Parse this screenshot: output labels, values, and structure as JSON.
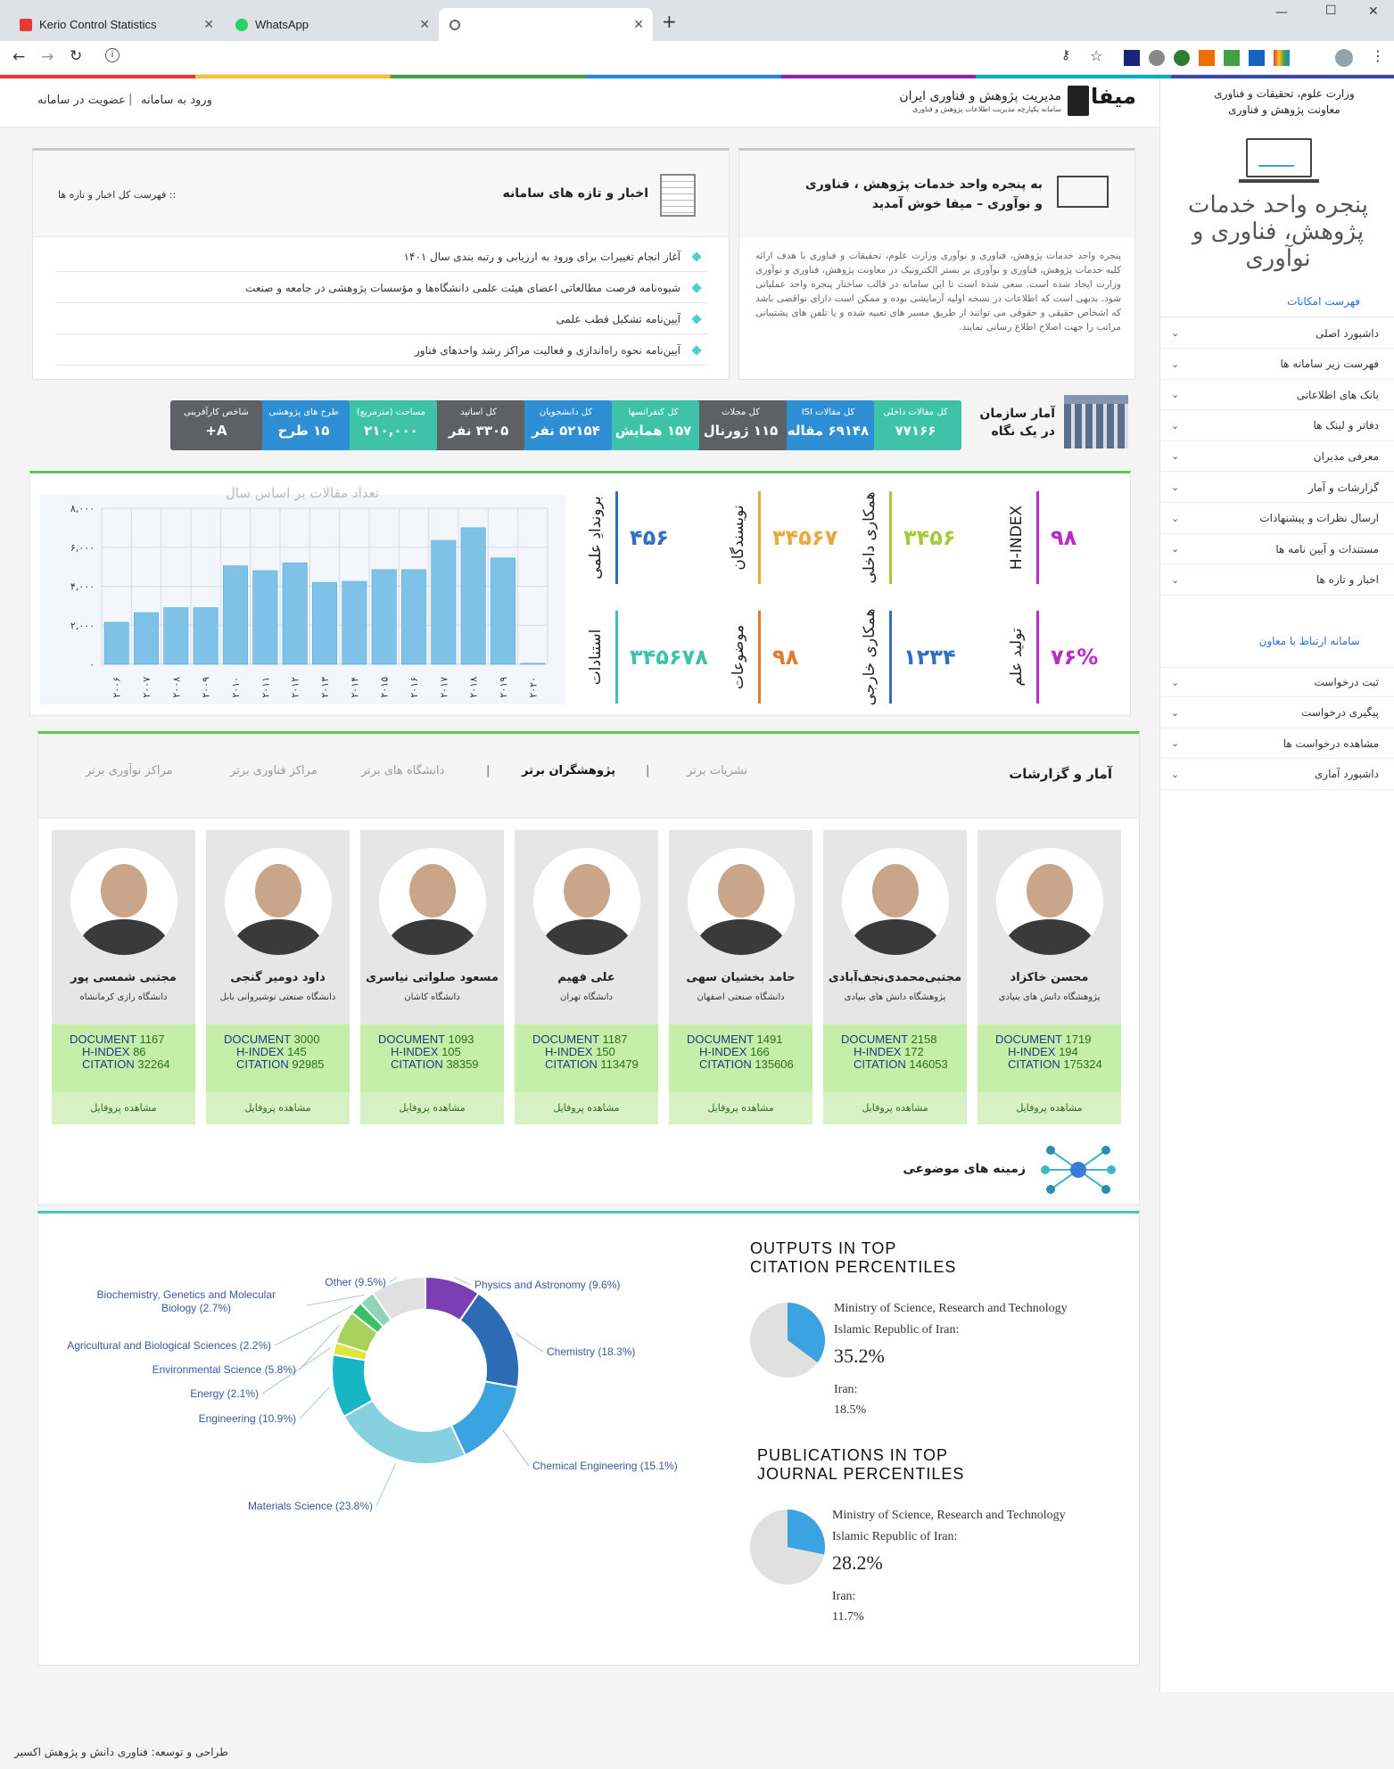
{
  "browser": {
    "tabs": [
      {
        "title": "Kerio Control Statistics"
      },
      {
        "title": "WhatsApp"
      },
      {
        "title": ""
      }
    ],
    "new_tab": "+",
    "window_controls": [
      "—",
      "☐",
      "✕"
    ],
    "address": ""
  },
  "header": {
    "ministry_line1": "وزارت علوم، تحقیقات و فناوری",
    "ministry_line2": "معاونت پژوهش و فناوری",
    "brand_title": "مدیریت پژوهش و فناوری ایران",
    "brand_subtitle": "سامانه یکپارچه مدیریت اطلاعات پژوهش و فناوری",
    "logo_text": "میفا",
    "login": "ورود به سامانه",
    "separator": "|",
    "register": "عضویت در سامانه"
  },
  "sidebar": {
    "hero_text": "پنجره واحد خدمات پژوهش، فناوری و نوآوری",
    "menu_title": "فهرست امکانات",
    "items": [
      {
        "label": "داشبورد اصلی"
      },
      {
        "label": "فهرست زیر سامانه ها"
      },
      {
        "label": "بانک های اطلاعاتی"
      },
      {
        "label": "دفاتر و لینک ها"
      },
      {
        "label": "معرفی مدیران"
      },
      {
        "label": "گزارشات و آمار"
      },
      {
        "label": "ارسال نظرات و پیشنهادات"
      },
      {
        "label": "مستندات و آیین نامه ها"
      },
      {
        "label": "اخبار و تازه ها"
      }
    ],
    "contact_title": "سامانه ارتباط با معاون",
    "contact_items": [
      {
        "label": "ثبت درخواست"
      },
      {
        "label": "پیگیری درخواست"
      },
      {
        "label": "مشاهده درخواست ها"
      },
      {
        "label": "داشبورد آماری"
      }
    ]
  },
  "welcome": {
    "title_line1": "به پنجره واحد خدمات پژوهش ، فناوری",
    "title_line2": "و نوآوری – میفا خوش آمدید",
    "body": "پنجره واحد خدمات پژوهش، فناوری و نوآوری وزارت علوم، تحقیقات و فناوری با هدف ارائه کلیه خدمات پژوهش، فناوری و نوآوری بر بستر الکترونیک در معاونت پژوهش، فناوری و نوآوری وزارت ایجاد شده است. سعی شده است تا این سامانه در قالب ساختار پنجره واحد عملیاتی شود. بدیهی است که اطلاعات در نسخه اولیه آزمایشی بوده و ممکن است دارای نواقصی باشد که اشخاص حقیقی و حقوقی می توانند از طریق مسیر های تعبیه شده و یا تلفن های پشتیبانی مراتب را جهت اصلاح اطلاع رسانی نمایند."
  },
  "news": {
    "title": "اخبار و تازه های سامانه",
    "all_link": ":: فهرست کل اخبار و تازه ها",
    "items": [
      {
        "text": "آغاز انجام تغییرات برای ورود به ارزیابی و رتبه بندی سال ۱۴۰۱"
      },
      {
        "text": "شیوه‌نامه فرصت مطالعاتی اعضای هیئت علمی دانشگاه‌ها و مؤسسات پژوهشی در جامعه و صنعت"
      },
      {
        "text": "آیین‌نامه تشکیل قطب علمی"
      },
      {
        "text": "آیین‌نامه نحوه راه‌اندازی و فعالیت مراکز رشد واحدهای فناور"
      }
    ]
  },
  "org_stats": {
    "title_line1": "آمار سازمان",
    "title_line2": "در یک نگاه",
    "boxes": [
      {
        "label": "کل مقالات داخلی",
        "value": "۷۷۱۶۶",
        "color": "#3ec3a9"
      },
      {
        "label": "کل مقالات ISI",
        "value": "۶۹۱۴۸ مقاله",
        "color": "#2f8fd4"
      },
      {
        "label": "کل مجلات",
        "value": "۱۱۵ ژورنال",
        "color": "#5d6166"
      },
      {
        "label": "کل کنفرانسها",
        "value": "۱۵۷ همایش",
        "color": "#3ec3a9"
      },
      {
        "label": "کل دانشجویان",
        "value": "۵۲۱۵۴ نفر",
        "color": "#2f8fd4"
      },
      {
        "label": "کل اساتید",
        "value": "۳۳۰۵ نفر",
        "color": "#5d6166"
      },
      {
        "label": "مساحت (مترمربع)",
        "value": "۲۱۰,۰۰۰",
        "color": "#3ec3a9"
      },
      {
        "label": "طرح های پژوهشی",
        "value": "۱۵ طرح",
        "color": "#2f8fd4"
      },
      {
        "label": "شاخص کارآفرینی",
        "value": "A+",
        "color": "#5d6166"
      }
    ]
  },
  "kpis": [
    {
      "label": "H-INDEX",
      "value": "۹۸",
      "color": "#b72ec7"
    },
    {
      "label": "همکاری داخلی",
      "value": "۳۴۵۶",
      "color": "#a5c93a"
    },
    {
      "label": "نویسندگان",
      "value": "۳۴۵۶۷",
      "color": "#e9a83a"
    },
    {
      "label": "بروندادِ علمی",
      "value": "۴۵۶",
      "color": "#2f6fbf"
    },
    {
      "label": "تولید علم",
      "value": "۷۶%",
      "color": "#b72ec7"
    },
    {
      "label": "همکاری خارجی",
      "value": "۱۲۳۴",
      "color": "#2f6fbf"
    },
    {
      "label": "موضوعات",
      "value": "۹۸",
      "color": "#e07b2d"
    },
    {
      "label": "استنادات",
      "value": "۳۴۵۶۷۸",
      "color": "#3ec3a9"
    }
  ],
  "chart_data": [
    {
      "type": "bar",
      "title": "تعداد مقالات بر اساس سال",
      "categories": [
        "۲۰۰۶",
        "۲۰۰۷",
        "۲۰۰۸",
        "۲۰۰۹",
        "۲۰۱۰",
        "۲۰۱۱",
        "۲۰۱۲",
        "۲۰۱۳",
        "۲۰۱۴",
        "۲۰۱۵",
        "۲۰۱۶",
        "۲۰۱۷",
        "۲۰۱۸",
        "۲۰۱۹",
        "۲۰۲۰"
      ],
      "values": [
        2150,
        2650,
        2900,
        2900,
        5050,
        4800,
        5200,
        4200,
        4250,
        4850,
        4850,
        6350,
        7000,
        5450,
        50
      ],
      "ylim": [
        0,
        8000
      ],
      "yticks": [
        "۰",
        "۲,۰۰۰",
        "۴,۰۰۰",
        "۶,۰۰۰",
        "۸,۰۰۰"
      ],
      "bar_color": "#7ec2e8",
      "grid": true
    },
    {
      "type": "pie",
      "categories": [
        "Physics and Astronomy",
        "Chemistry",
        "Chemical Engineering",
        "Materials Science",
        "Engineering",
        "Energy",
        "Environmental Science",
        "Agricultural and Biological Sciences",
        "Biochemistry, Genetics and Molecular Biology",
        "Other"
      ],
      "labels": [
        "Physics and Astronomy (9.6%)",
        "Chemistry (18.3%)",
        "Chemical Engineering (15.1%)",
        "Materials Science (23.8%)",
        "Engineering (10.9%)",
        "Energy (2.1%)",
        "Environmental Science (5.8%)",
        "Agricultural and Biological Sciences (2.2%)",
        "Biochemistry, Genetics and Molecular Biology (2.7%)",
        "Other (9.5%)"
      ],
      "values": [
        9.6,
        18.3,
        15.1,
        23.8,
        10.9,
        2.1,
        5.8,
        2.2,
        2.7,
        9.5
      ],
      "colors": [
        "#7b3fb3",
        "#2b6cb5",
        "#3aa3e0",
        "#86d0e0",
        "#16b6c4",
        "#dfe63a",
        "#a6d15a",
        "#3bbf6a",
        "#8fd3b8",
        "#e0e0e0"
      ]
    },
    {
      "type": "pie",
      "title": "OUTPUTS IN TOP CITATION PERCENTILES",
      "categories": [
        "Ministry of Science, Research and Technology Islamic Republic of Iran",
        "Other"
      ],
      "values": [
        35.2,
        64.8
      ],
      "colors": [
        "#3aa3e0",
        "#e0e0e0"
      ]
    },
    {
      "type": "pie",
      "title": "PUBLICATIONS IN TOP JOURNAL PERCENTILES",
      "categories": [
        "Ministry of Science, Research and Technology Islamic Republic of Iran",
        "Other"
      ],
      "values": [
        28.2,
        71.8
      ],
      "colors": [
        "#3aa3e0",
        "#e0e0e0"
      ]
    }
  ],
  "reports": {
    "title": "آمار و گزارشات",
    "tabs": [
      {
        "label": "نشریات برتر"
      },
      {
        "label": "پژوهشگران برتر"
      },
      {
        "label": "دانشگاه های برتر"
      },
      {
        "label": "مراکز فناوری برتر"
      },
      {
        "label": "مراکز نوآوری برتر"
      }
    ],
    "sep": "|"
  },
  "researchers": [
    {
      "name": "محسن خاکزاد",
      "uni": "پژوهشگاه دانش های بنیادی",
      "document": "1719",
      "hindex": "194",
      "citation": "175324",
      "link": "مشاهده پروفایل"
    },
    {
      "name": "مجتبی‌محمدی‌نجف‌آبادی",
      "uni": "پژوهشگاه دانش های بنیادی",
      "document": "2158",
      "hindex": "172",
      "citation": "146053",
      "link": "مشاهده پروفایل"
    },
    {
      "name": "حامد بخشیان سهی",
      "uni": "دانشگاه صنعتی اصفهان",
      "document": "1491",
      "hindex": "166",
      "citation": "135606",
      "link": "مشاهده پروفایل"
    },
    {
      "name": "علی فهیم",
      "uni": "دانشگاه تهران",
      "document": "1187",
      "hindex": "150",
      "citation": "113479",
      "link": "مشاهده پروفایل"
    },
    {
      "name": "مسعود صلواتی نیاسری",
      "uni": "دانشگاه کاشان",
      "document": "1093",
      "hindex": "105",
      "citation": "38359",
      "link": "مشاهده پروفایل"
    },
    {
      "name": "داود دومیر گنجی",
      "uni": "دانشگاه صنعتی نوشیروانی بابل",
      "document": "3000",
      "hindex": "145",
      "citation": "92985",
      "link": "مشاهده پروفایل"
    },
    {
      "name": "مجتبی شمسی پور",
      "uni": "دانشگاه رازی کرمانشاه",
      "document": "1167",
      "hindex": "86",
      "citation": "32264",
      "link": "مشاهده پروفایل"
    }
  ],
  "metric_labels": {
    "document": "DOCUMENT",
    "hindex": "H-INDEX",
    "citation": "CITATION"
  },
  "subjects": {
    "title": "زمینه های موضوعی"
  },
  "citation_panels": [
    {
      "title_line1": "OUTPUTS IN TOP",
      "title_line2": "CITATION PERCENTILES",
      "org_line1": "Ministry of Science, Research and Technology",
      "org_line2": "Islamic Republic of Iran:",
      "org_value": "35.2%",
      "iran_label": "Iran:",
      "iran_value": "18.5%"
    },
    {
      "title_line1": "PUBLICATIONS IN TOP",
      "title_line2": "JOURNAL PERCENTILES",
      "org_line1": "Ministry of Science, Research and Technology",
      "org_line2": "Islamic Republic of Iran:",
      "org_value": "28.2%",
      "iran_label": "Iran:",
      "iran_value": "11.7%"
    }
  ],
  "footer": {
    "text": "طراحی و توسعه: فناوری دانش و پژوهش اکسیر"
  }
}
